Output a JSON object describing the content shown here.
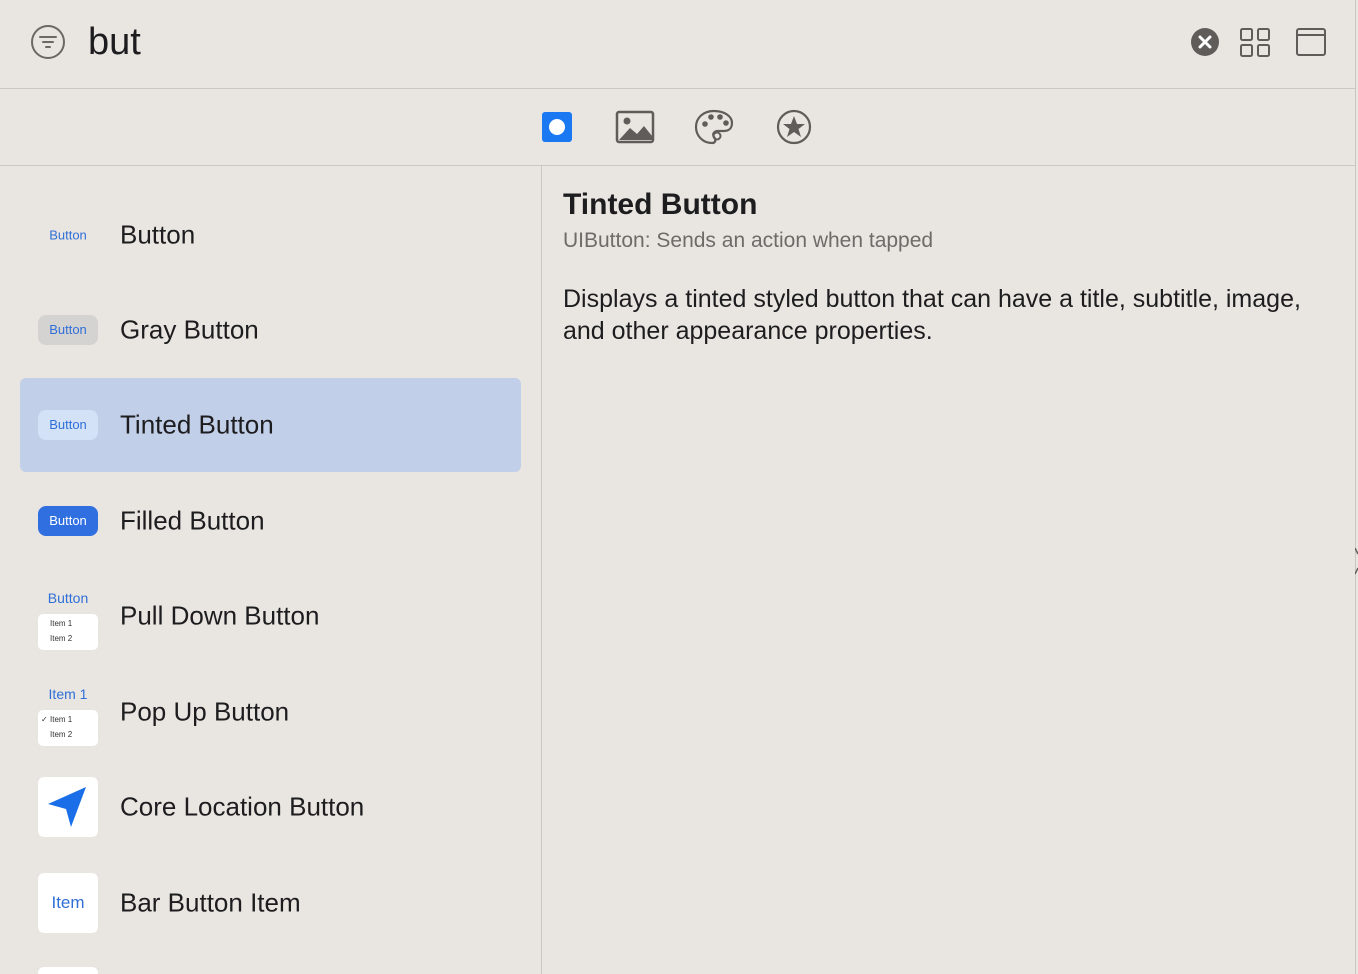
{
  "search": {
    "query": "but"
  },
  "library_tabs": [
    {
      "name": "objects",
      "selected": true
    },
    {
      "name": "media",
      "selected": false
    },
    {
      "name": "colors",
      "selected": false
    },
    {
      "name": "favorites",
      "selected": false
    }
  ],
  "list": {
    "selected_index": 2,
    "items": [
      {
        "label": "Button",
        "thumb_text": "Button"
      },
      {
        "label": "Gray Button",
        "thumb_text": "Button"
      },
      {
        "label": "Tinted Button",
        "thumb_text": "Button"
      },
      {
        "label": "Filled Button",
        "thumb_text": "Button"
      },
      {
        "label": "Pull Down Button",
        "thumb_title": "Button",
        "menu_items": [
          "Item 1",
          "Item 2"
        ]
      },
      {
        "label": "Pop Up Button",
        "thumb_title": "Item 1",
        "menu_items": [
          "Item 1",
          "Item 2"
        ],
        "check": "✓"
      },
      {
        "label": "Core Location Button",
        "icon": "location-arrow-icon"
      },
      {
        "label": "Bar Button Item",
        "thumb_text": "Item"
      }
    ]
  },
  "detail": {
    "title": "Tinted Button",
    "subtitle": "UIButton: Sends an action when tapped",
    "description": "Displays a tinted styled button that can have a title, subtitle, image, and other appearance properties."
  },
  "colors": {
    "accent": "#2f6fe0",
    "selection": "#c2cfe8",
    "background": "#e9e5e1"
  }
}
